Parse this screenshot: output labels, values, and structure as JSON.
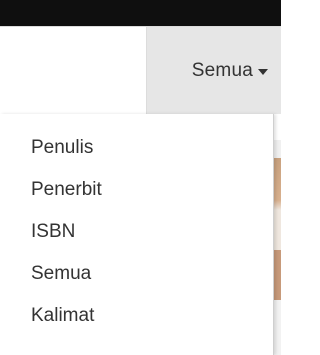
{
  "search": {
    "placeholder": "",
    "value": ""
  },
  "dropdown": {
    "selected_label": "Semua",
    "options": [
      "Penulis",
      "Penerbit",
      "ISBN",
      "Semua",
      "Kalimat"
    ]
  },
  "colors": {
    "topbar": "#0f0f0f",
    "toggle_background": "#e6e6e6",
    "text": "#333333"
  },
  "icons": {
    "toggle": "caret-down-icon"
  }
}
